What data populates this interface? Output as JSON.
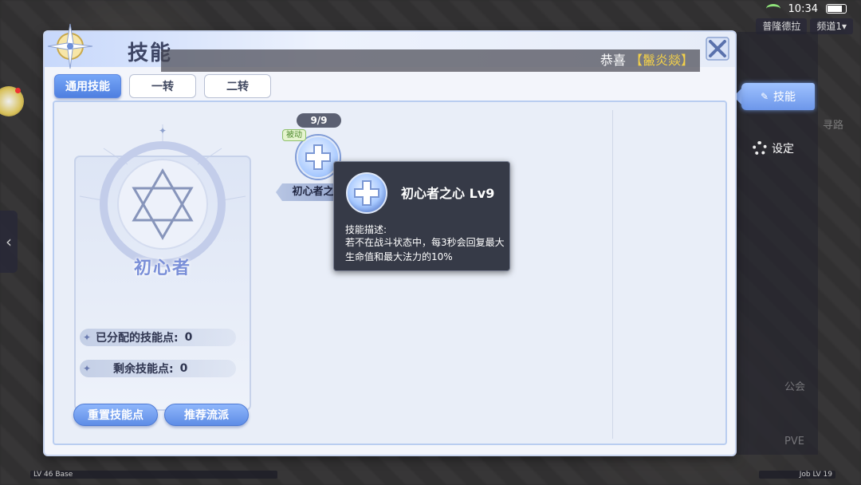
{
  "status": {
    "time": "10:34"
  },
  "top_chips": [
    "普隆德拉",
    "频道1▾"
  ],
  "panel": {
    "title": "技能",
    "notice_prefix": "恭喜",
    "notice_highlight": "【鬣炎燚】"
  },
  "tabs": [
    {
      "label": "通用技能",
      "active": true
    },
    {
      "label": "一转",
      "active": false
    },
    {
      "label": "二转",
      "active": false
    }
  ],
  "class_card": {
    "name": "初心者",
    "allocated_label": "已分配的技能点:",
    "allocated_value": "0",
    "remaining_label": "剩余技能点:",
    "remaining_value": "0",
    "reset_button": "重置技能点",
    "recommend_button": "推荐流派"
  },
  "skill": {
    "level": "9/9",
    "badge": "被动",
    "label": "初心者之心"
  },
  "tooltip": {
    "title": "初心者之心 Lv9",
    "desc_label": "技能描述:",
    "desc": "若不在战斗状态中，每3秒会回复最大生命值和最大法力的10%"
  },
  "side_menu": {
    "skill_label": "技能",
    "setting_label": "设定",
    "route_label": "寻路",
    "pve_label": "PVE",
    "guild_label": "公会"
  },
  "bottom": {
    "level_left": "LV 46 Base",
    "level_right": "Job LV 19"
  }
}
